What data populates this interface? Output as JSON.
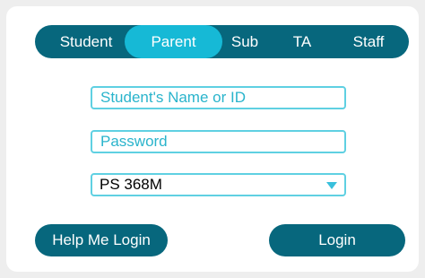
{
  "role_tabs": [
    {
      "label": "Student",
      "active": false
    },
    {
      "label": "Parent",
      "active": true
    },
    {
      "label": "Sub",
      "active": false
    },
    {
      "label": "TA",
      "active": false
    },
    {
      "label": "Staff",
      "active": false
    }
  ],
  "form": {
    "username_placeholder": "Student's Name or ID",
    "password_placeholder": "Password",
    "school_selected": "PS 368M"
  },
  "buttons": {
    "help_label": "Help Me Login",
    "login_label": "Login"
  },
  "colors": {
    "primary": "#07677d",
    "active_tab": "#16b9d6",
    "field_border": "#5fd0e2",
    "placeholder": "#2ab4cc"
  },
  "icons": {
    "select_arrow": "caret-down-icon"
  }
}
